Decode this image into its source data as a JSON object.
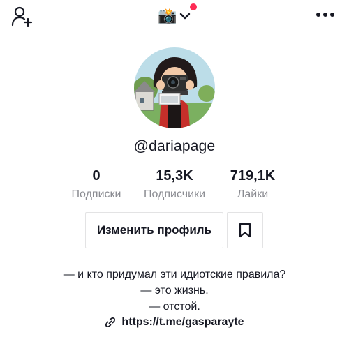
{
  "header": {
    "account_emoji": "📸",
    "icons": {
      "add_user": "add-user-icon",
      "switch": "chevron-down-icon",
      "more": "more-horizontal-icon"
    },
    "notification_color": "#fe2c55"
  },
  "profile": {
    "username": "@dariapage",
    "stats": [
      {
        "value": "0",
        "label": "Подписки"
      },
      {
        "value": "15,3K",
        "label": "Подписчики"
      },
      {
        "value": "719,1K",
        "label": "Лайки"
      }
    ],
    "edit_button_label": "Изменить профиль",
    "bookmark_icon": "bookmark-icon",
    "bio_lines": [
      "— и кто придумал эти идиотские правила?",
      "— это жизнь.",
      "— отстой."
    ],
    "link": "https://t.me/gasparayte",
    "link_icon": "link-icon"
  }
}
